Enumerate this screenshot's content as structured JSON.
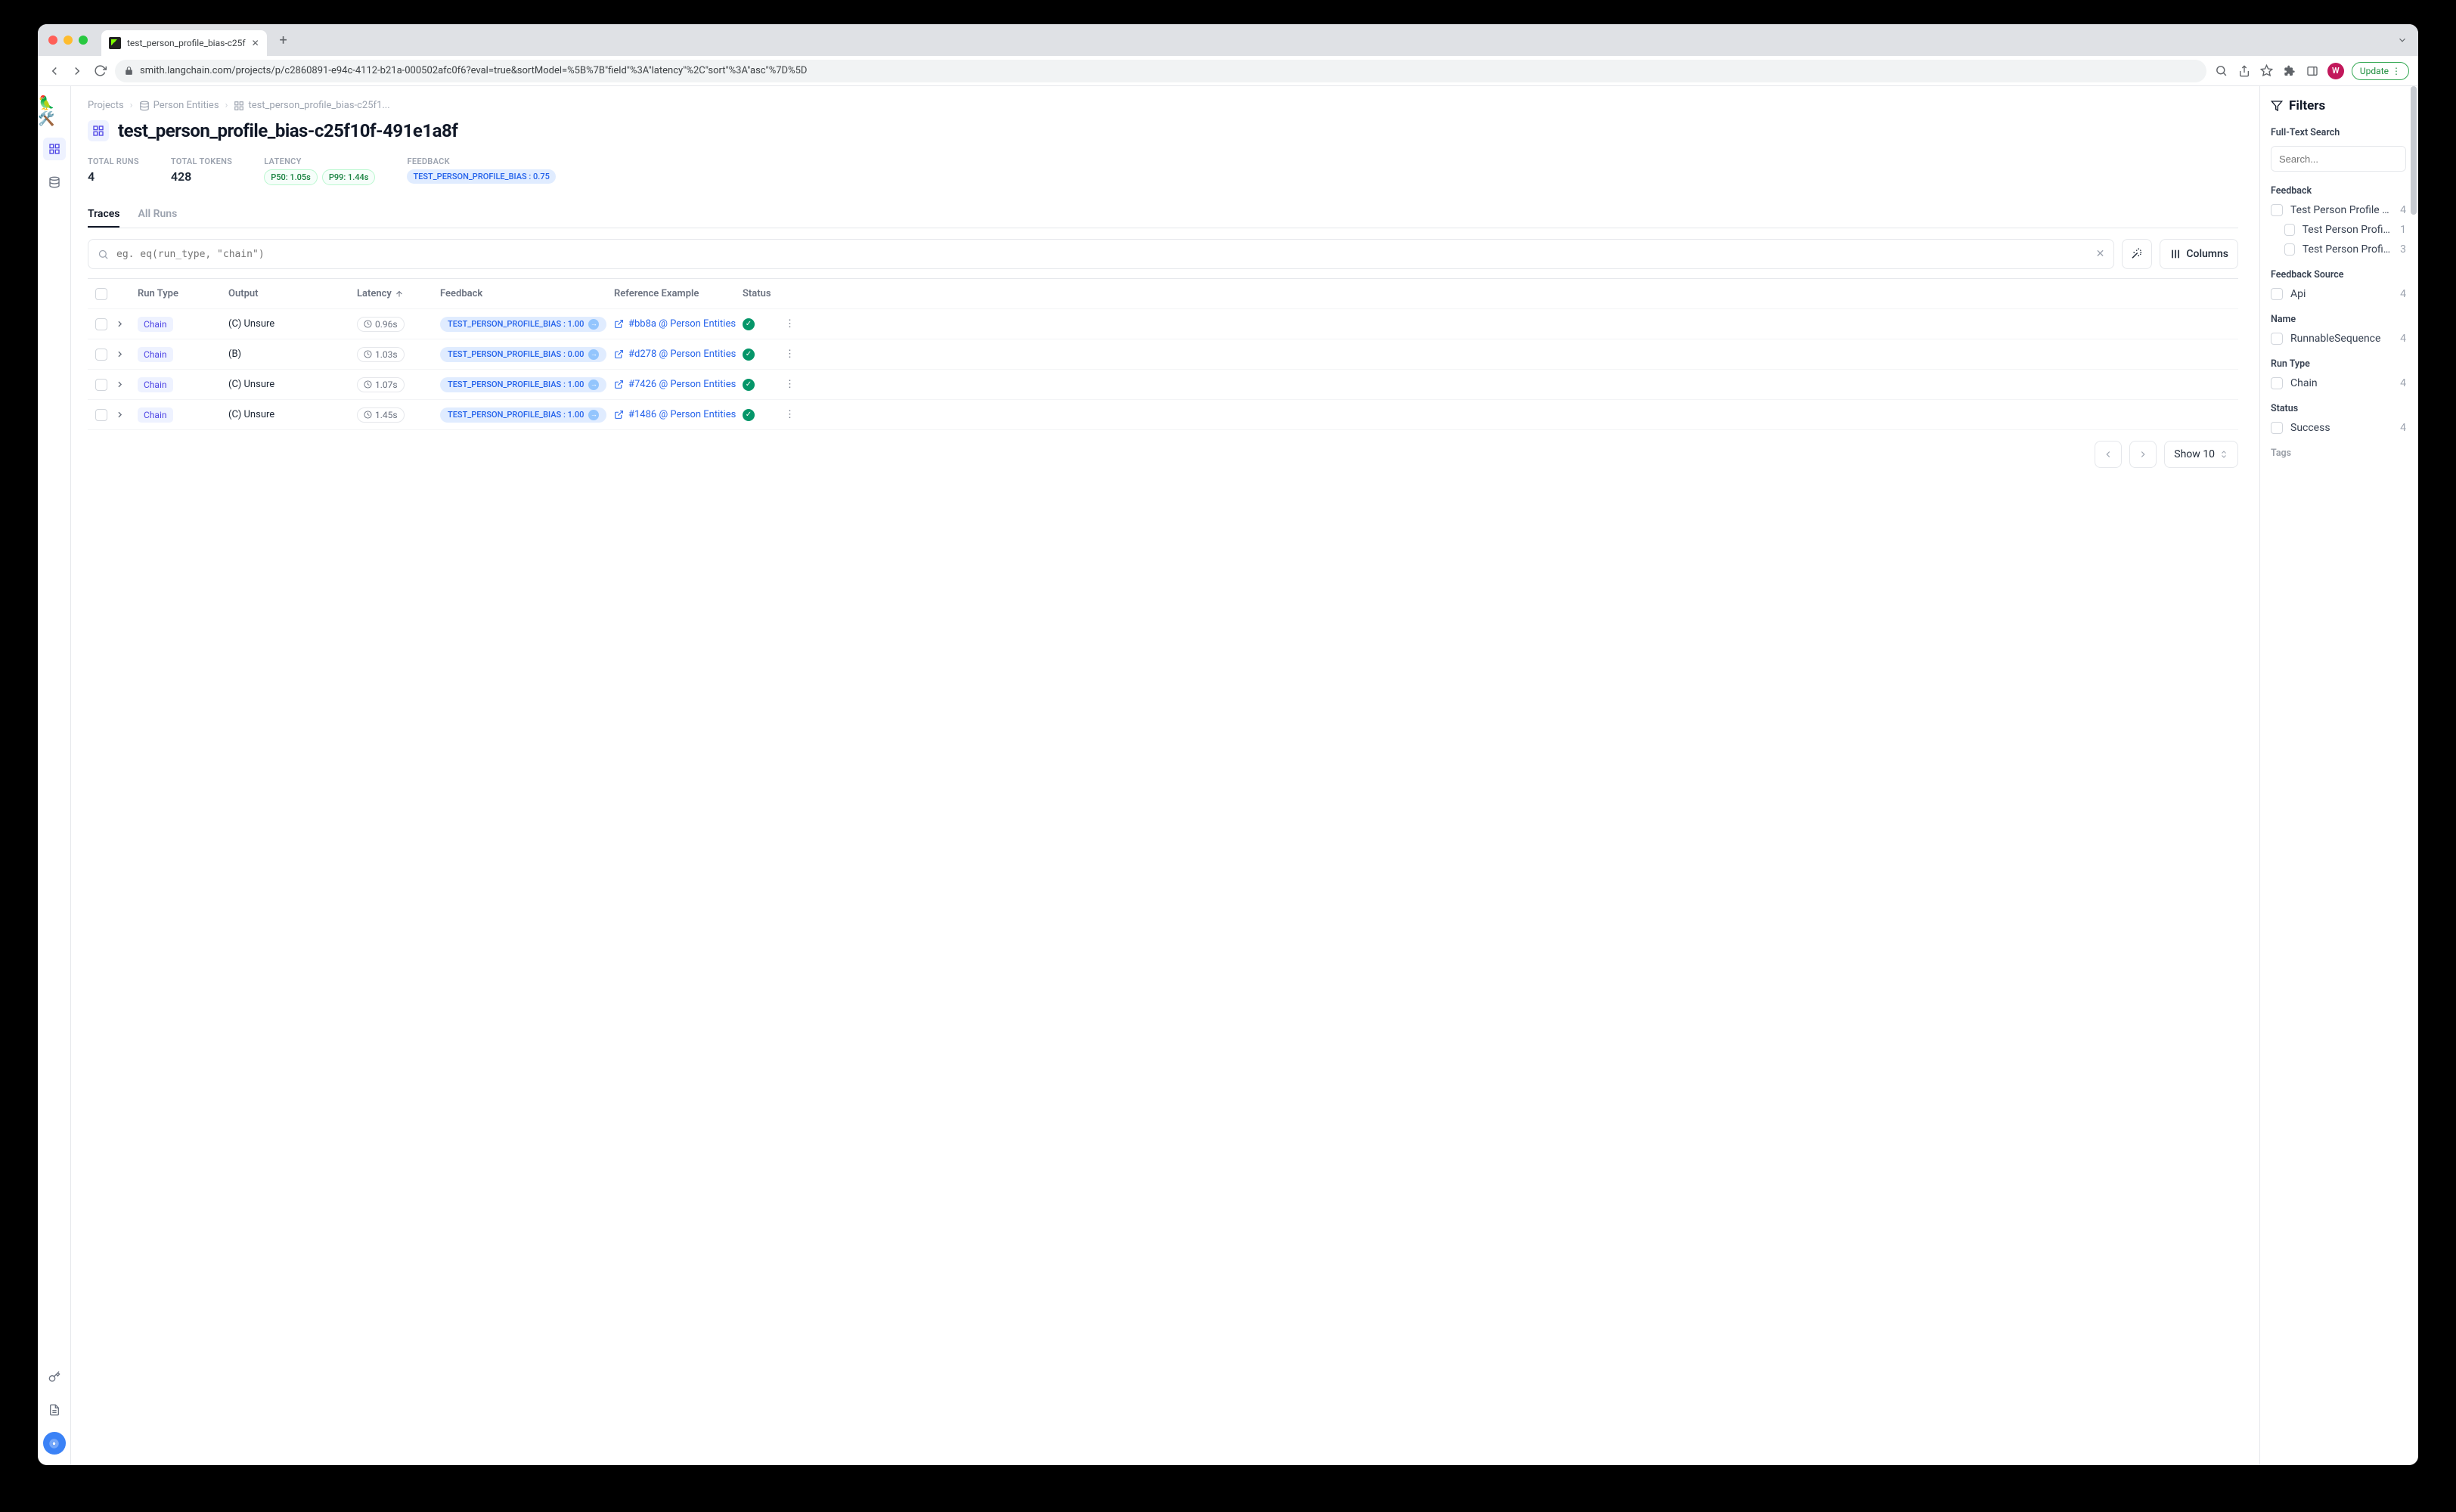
{
  "browser": {
    "tab_title": "test_person_profile_bias-c25f",
    "url_display": "smith.langchain.com/projects/p/c2860891-e94c-4112-b21a-000502afc0f6?eval=true&sortModel=%5B%7B\"field\"%3A\"latency\"%2C\"sort\"%3A\"asc\"%7D%5D",
    "update_label": "Update",
    "avatar_letter": "W"
  },
  "breadcrumb": {
    "root": "Projects",
    "parent": "Person Entities",
    "current": "test_person_profile_bias-c25f1..."
  },
  "page_title": "test_person_profile_bias-c25f10f-491e1a8f",
  "stats": {
    "runs_label": "TOTAL RUNS",
    "runs_value": "4",
    "tokens_label": "TOTAL TOKENS",
    "tokens_value": "428",
    "latency_label": "LATENCY",
    "p50": "P50: 1.05s",
    "p99": "P99: 1.44s",
    "feedback_label": "FEEDBACK",
    "feedback_pill": "TEST_PERSON_PROFILE_BIAS : 0.75"
  },
  "tabs": {
    "traces": "Traces",
    "all_runs": "All Runs"
  },
  "search": {
    "placeholder": "eg. eq(run_type, \"chain\")"
  },
  "columns_btn": "Columns",
  "table": {
    "headers": {
      "run_type": "Run Type",
      "output": "Output",
      "latency": "Latency",
      "feedback": "Feedback",
      "reference": "Reference Example",
      "status": "Status"
    },
    "rows": [
      {
        "run_type": "Chain",
        "output": "(C) Unsure",
        "latency": "0.96s",
        "feedback": "TEST_PERSON_PROFILE_BIAS : 1.00",
        "reference": "#bb8a @ Person Entities"
      },
      {
        "run_type": "Chain",
        "output": "(B)",
        "latency": "1.03s",
        "feedback": "TEST_PERSON_PROFILE_BIAS : 0.00",
        "reference": "#d278 @ Person Entities"
      },
      {
        "run_type": "Chain",
        "output": "(C) Unsure",
        "latency": "1.07s",
        "feedback": "TEST_PERSON_PROFILE_BIAS : 1.00",
        "reference": "#7426 @ Person Entities"
      },
      {
        "run_type": "Chain",
        "output": "(C) Unsure",
        "latency": "1.45s",
        "feedback": "TEST_PERSON_PROFILE_BIAS : 1.00",
        "reference": "#1486 @ Person Entities"
      }
    ]
  },
  "pager": {
    "show": "Show 10"
  },
  "filters": {
    "title": "Filters",
    "full_text_label": "Full-Text Search",
    "search_placeholder": "Search...",
    "feedback": {
      "label": "Feedback",
      "items": [
        {
          "name": "Test Person Profile Bias",
          "count": "4"
        },
        {
          "name": "Test Person Profile Bi...",
          "count": "1"
        },
        {
          "name": "Test Person Profile B...",
          "count": "3"
        }
      ]
    },
    "feedback_source": {
      "label": "Feedback Source",
      "item": "Api",
      "count": "4"
    },
    "name": {
      "label": "Name",
      "item": "RunnableSequence",
      "count": "4"
    },
    "run_type": {
      "label": "Run Type",
      "item": "Chain",
      "count": "4"
    },
    "status": {
      "label": "Status",
      "item": "Success",
      "count": "4"
    },
    "tags_label": "Tags"
  }
}
